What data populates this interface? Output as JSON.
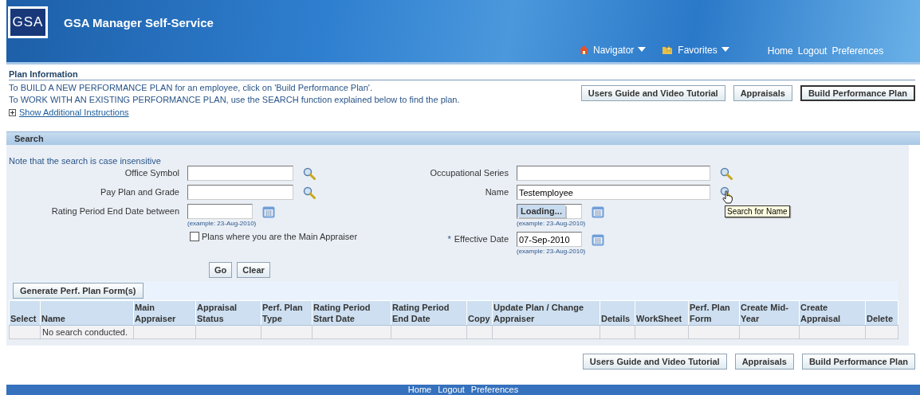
{
  "header": {
    "logo": "GSA",
    "title": "GSA Manager Self-Service",
    "menus": [
      {
        "kind": "navigator",
        "label": "Navigator"
      },
      {
        "kind": "favorites",
        "label": "Favorites"
      }
    ],
    "links": [
      "Home",
      "Logout",
      "Preferences"
    ]
  },
  "plan_information": {
    "title": "Plan Information",
    "lines": [
      "To BUILD A NEW PERFORMANCE PLAN for an employee, click on 'Build Performance Plan'.",
      "To WORK WITH AN EXISTING PERFORMANCE PLAN, use the SEARCH function explained below to find the plan."
    ],
    "toggle": "Show Additional Instructions",
    "buttons": [
      {
        "label": "Users Guide and Video Tutorial",
        "focused": false
      },
      {
        "label": "Appraisals",
        "focused": false
      },
      {
        "label": "Build Performance Plan",
        "focused": true
      }
    ]
  },
  "search": {
    "title": "Search",
    "note": "Note that the search is case insensitive",
    "left_fields": [
      {
        "kind": "lookup",
        "label": "Office Symbol"
      },
      {
        "kind": "lookup",
        "label": "Pay Plan and Grade"
      },
      {
        "kind": "date",
        "label": "Rating Period End Date between",
        "hint": "(example: 23-Aug-2010)"
      },
      {
        "kind": "checkbox",
        "label": "Plans where you are the Main Appraiser",
        "checked": false
      }
    ],
    "right_fields": [
      {
        "kind": "lookup",
        "label": "Occupational Series"
      },
      {
        "kind": "lookup",
        "label": "Name",
        "value": "Testemployee",
        "tooltip": "Search for Name"
      },
      {
        "kind": "date",
        "overlay": "Loading...",
        "hint": "(example: 23-Aug-2010)"
      },
      {
        "kind": "date",
        "required_mark": "*",
        "label": "Effective Date",
        "value": "07-Sep-2010",
        "hint": "(example: 23-Aug-2010)"
      }
    ],
    "buttons": [
      "Go",
      "Clear"
    ]
  },
  "results": {
    "button": "Generate Perf. Plan Form(s)",
    "columns": [
      "Select",
      "Name",
      "Main Appraiser",
      "Appraisal Status",
      "Perf. Plan Type",
      "Rating Period Start Date",
      "Rating Period End Date",
      "Copy",
      "Update Plan / Change Appraiser",
      "Details",
      "WorkSheet",
      "Perf. Plan Form",
      "Create Mid-Year",
      "Create Appraisal",
      "Delete"
    ],
    "empty_message": "No search conducted."
  },
  "bottom_buttons": [
    {
      "label": "Users Guide and Video Tutorial",
      "focused": false
    },
    {
      "label": "Appraisals",
      "focused": false
    },
    {
      "label": "Build Performance Plan",
      "focused": false
    }
  ],
  "footer_links": [
    "Home",
    "Logout",
    "Preferences"
  ]
}
